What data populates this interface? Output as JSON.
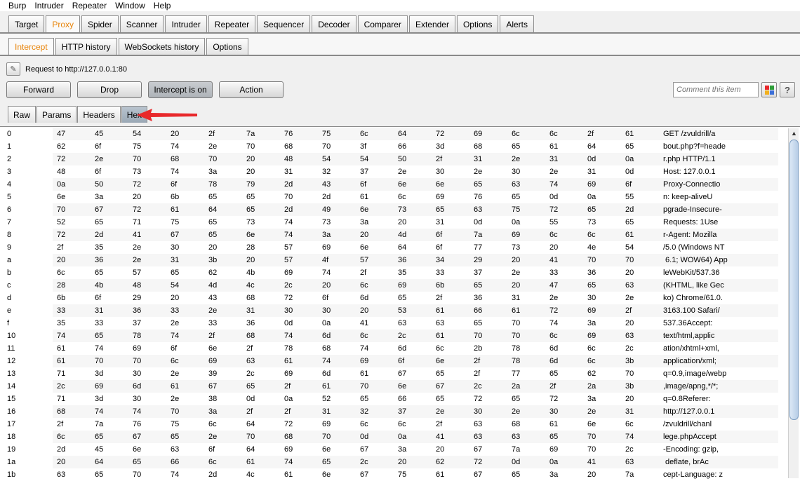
{
  "menu": [
    "Burp",
    "Intruder",
    "Repeater",
    "Window",
    "Help"
  ],
  "main_tabs": [
    {
      "label": "Target",
      "active": false
    },
    {
      "label": "Proxy",
      "active": true
    },
    {
      "label": "Spider",
      "active": false
    },
    {
      "label": "Scanner",
      "active": false
    },
    {
      "label": "Intruder",
      "active": false
    },
    {
      "label": "Repeater",
      "active": false
    },
    {
      "label": "Sequencer",
      "active": false
    },
    {
      "label": "Decoder",
      "active": false
    },
    {
      "label": "Comparer",
      "active": false
    },
    {
      "label": "Extender",
      "active": false
    },
    {
      "label": "Options",
      "active": false
    },
    {
      "label": "Alerts",
      "active": false
    }
  ],
  "proxy_tabs": [
    {
      "label": "Intercept",
      "active": true
    },
    {
      "label": "HTTP history",
      "active": false
    },
    {
      "label": "WebSockets history",
      "active": false
    },
    {
      "label": "Options",
      "active": false
    }
  ],
  "intercept": {
    "request_label": "Request to http://127.0.0.1:80",
    "forward": "Forward",
    "drop": "Drop",
    "intercept_toggle": "Intercept is on",
    "action": "Action",
    "comment_placeholder": "Comment this item",
    "help": "?"
  },
  "view_tabs": [
    {
      "label": "Raw",
      "active": false
    },
    {
      "label": "Params",
      "active": false
    },
    {
      "label": "Headers",
      "active": false
    },
    {
      "label": "Hex",
      "active": true
    }
  ],
  "colors": {
    "accent": "#e8850c",
    "arrow": "#e8282b"
  },
  "hex_rows": [
    {
      "addr": "0",
      "bytes": [
        "47",
        "45",
        "54",
        "20",
        "2f",
        "7a",
        "76",
        "75",
        "6c",
        "64",
        "72",
        "69",
        "6c",
        "6c",
        "2f",
        "61"
      ],
      "ascii": "GET /zvuldrill/a"
    },
    {
      "addr": "1",
      "bytes": [
        "62",
        "6f",
        "75",
        "74",
        "2e",
        "70",
        "68",
        "70",
        "3f",
        "66",
        "3d",
        "68",
        "65",
        "61",
        "64",
        "65"
      ],
      "ascii": "bout.php?f=heade"
    },
    {
      "addr": "2",
      "bytes": [
        "72",
        "2e",
        "70",
        "68",
        "70",
        "20",
        "48",
        "54",
        "54",
        "50",
        "2f",
        "31",
        "2e",
        "31",
        "0d",
        "0a"
      ],
      "ascii": "r.php HTTP/1.1"
    },
    {
      "addr": "3",
      "bytes": [
        "48",
        "6f",
        "73",
        "74",
        "3a",
        "20",
        "31",
        "32",
        "37",
        "2e",
        "30",
        "2e",
        "30",
        "2e",
        "31",
        "0d"
      ],
      "ascii": "Host: 127.0.0.1"
    },
    {
      "addr": "4",
      "bytes": [
        "0a",
        "50",
        "72",
        "6f",
        "78",
        "79",
        "2d",
        "43",
        "6f",
        "6e",
        "6e",
        "65",
        "63",
        "74",
        "69",
        "6f"
      ],
      "ascii": "Proxy-Connectio"
    },
    {
      "addr": "5",
      "bytes": [
        "6e",
        "3a",
        "20",
        "6b",
        "65",
        "65",
        "70",
        "2d",
        "61",
        "6c",
        "69",
        "76",
        "65",
        "0d",
        "0a",
        "55"
      ],
      "ascii": "n: keep-aliveU"
    },
    {
      "addr": "6",
      "bytes": [
        "70",
        "67",
        "72",
        "61",
        "64",
        "65",
        "2d",
        "49",
        "6e",
        "73",
        "65",
        "63",
        "75",
        "72",
        "65",
        "2d"
      ],
      "ascii": "pgrade-Insecure-"
    },
    {
      "addr": "7",
      "bytes": [
        "52",
        "65",
        "71",
        "75",
        "65",
        "73",
        "74",
        "73",
        "3a",
        "20",
        "31",
        "0d",
        "0a",
        "55",
        "73",
        "65"
      ],
      "ascii": "Requests: 1Use"
    },
    {
      "addr": "8",
      "bytes": [
        "72",
        "2d",
        "41",
        "67",
        "65",
        "6e",
        "74",
        "3a",
        "20",
        "4d",
        "6f",
        "7a",
        "69",
        "6c",
        "6c",
        "61"
      ],
      "ascii": "r-Agent: Mozilla"
    },
    {
      "addr": "9",
      "bytes": [
        "2f",
        "35",
        "2e",
        "30",
        "20",
        "28",
        "57",
        "69",
        "6e",
        "64",
        "6f",
        "77",
        "73",
        "20",
        "4e",
        "54"
      ],
      "ascii": "/5.0 (Windows NT"
    },
    {
      "addr": "a",
      "bytes": [
        "20",
        "36",
        "2e",
        "31",
        "3b",
        "20",
        "57",
        "4f",
        "57",
        "36",
        "34",
        "29",
        "20",
        "41",
        "70",
        "70"
      ],
      "ascii": " 6.1; WOW64) App"
    },
    {
      "addr": "b",
      "bytes": [
        "6c",
        "65",
        "57",
        "65",
        "62",
        "4b",
        "69",
        "74",
        "2f",
        "35",
        "33",
        "37",
        "2e",
        "33",
        "36",
        "20"
      ],
      "ascii": "leWebKit/537.36"
    },
    {
      "addr": "c",
      "bytes": [
        "28",
        "4b",
        "48",
        "54",
        "4d",
        "4c",
        "2c",
        "20",
        "6c",
        "69",
        "6b",
        "65",
        "20",
        "47",
        "65",
        "63"
      ],
      "ascii": "(KHTML, like Gec"
    },
    {
      "addr": "d",
      "bytes": [
        "6b",
        "6f",
        "29",
        "20",
        "43",
        "68",
        "72",
        "6f",
        "6d",
        "65",
        "2f",
        "36",
        "31",
        "2e",
        "30",
        "2e"
      ],
      "ascii": "ko) Chrome/61.0."
    },
    {
      "addr": "e",
      "bytes": [
        "33",
        "31",
        "36",
        "33",
        "2e",
        "31",
        "30",
        "30",
        "20",
        "53",
        "61",
        "66",
        "61",
        "72",
        "69",
        "2f"
      ],
      "ascii": "3163.100 Safari/"
    },
    {
      "addr": "f",
      "bytes": [
        "35",
        "33",
        "37",
        "2e",
        "33",
        "36",
        "0d",
        "0a",
        "41",
        "63",
        "63",
        "65",
        "70",
        "74",
        "3a",
        "20"
      ],
      "ascii": "537.36Accept:"
    },
    {
      "addr": "10",
      "bytes": [
        "74",
        "65",
        "78",
        "74",
        "2f",
        "68",
        "74",
        "6d",
        "6c",
        "2c",
        "61",
        "70",
        "70",
        "6c",
        "69",
        "63"
      ],
      "ascii": "text/html,applic"
    },
    {
      "addr": "11",
      "bytes": [
        "61",
        "74",
        "69",
        "6f",
        "6e",
        "2f",
        "78",
        "68",
        "74",
        "6d",
        "6c",
        "2b",
        "78",
        "6d",
        "6c",
        "2c"
      ],
      "ascii": "ation/xhtml+xml,"
    },
    {
      "addr": "12",
      "bytes": [
        "61",
        "70",
        "70",
        "6c",
        "69",
        "63",
        "61",
        "74",
        "69",
        "6f",
        "6e",
        "2f",
        "78",
        "6d",
        "6c",
        "3b"
      ],
      "ascii": "application/xml;"
    },
    {
      "addr": "13",
      "bytes": [
        "71",
        "3d",
        "30",
        "2e",
        "39",
        "2c",
        "69",
        "6d",
        "61",
        "67",
        "65",
        "2f",
        "77",
        "65",
        "62",
        "70"
      ],
      "ascii": "q=0.9,image/webp"
    },
    {
      "addr": "14",
      "bytes": [
        "2c",
        "69",
        "6d",
        "61",
        "67",
        "65",
        "2f",
        "61",
        "70",
        "6e",
        "67",
        "2c",
        "2a",
        "2f",
        "2a",
        "3b"
      ],
      "ascii": ",image/apng,*/*;"
    },
    {
      "addr": "15",
      "bytes": [
        "71",
        "3d",
        "30",
        "2e",
        "38",
        "0d",
        "0a",
        "52",
        "65",
        "66",
        "65",
        "72",
        "65",
        "72",
        "3a",
        "20"
      ],
      "ascii": "q=0.8Referer:"
    },
    {
      "addr": "16",
      "bytes": [
        "68",
        "74",
        "74",
        "70",
        "3a",
        "2f",
        "2f",
        "31",
        "32",
        "37",
        "2e",
        "30",
        "2e",
        "30",
        "2e",
        "31"
      ],
      "ascii": "http://127.0.0.1"
    },
    {
      "addr": "17",
      "bytes": [
        "2f",
        "7a",
        "76",
        "75",
        "6c",
        "64",
        "72",
        "69",
        "6c",
        "6c",
        "2f",
        "63",
        "68",
        "61",
        "6e",
        "6c"
      ],
      "ascii": "/zvuldrill/chanl"
    },
    {
      "addr": "18",
      "bytes": [
        "6c",
        "65",
        "67",
        "65",
        "2e",
        "70",
        "68",
        "70",
        "0d",
        "0a",
        "41",
        "63",
        "63",
        "65",
        "70",
        "74"
      ],
      "ascii": "lege.phpAccept"
    },
    {
      "addr": "19",
      "bytes": [
        "2d",
        "45",
        "6e",
        "63",
        "6f",
        "64",
        "69",
        "6e",
        "67",
        "3a",
        "20",
        "67",
        "7a",
        "69",
        "70",
        "2c"
      ],
      "ascii": "-Encoding: gzip,"
    },
    {
      "addr": "1a",
      "bytes": [
        "20",
        "64",
        "65",
        "66",
        "6c",
        "61",
        "74",
        "65",
        "2c",
        "20",
        "62",
        "72",
        "0d",
        "0a",
        "41",
        "63"
      ],
      "ascii": " deflate, brAc"
    },
    {
      "addr": "1b",
      "bytes": [
        "63",
        "65",
        "70",
        "74",
        "2d",
        "4c",
        "61",
        "6e",
        "67",
        "75",
        "61",
        "67",
        "65",
        "3a",
        "20",
        "7a"
      ],
      "ascii": "cept-Language: z"
    }
  ]
}
